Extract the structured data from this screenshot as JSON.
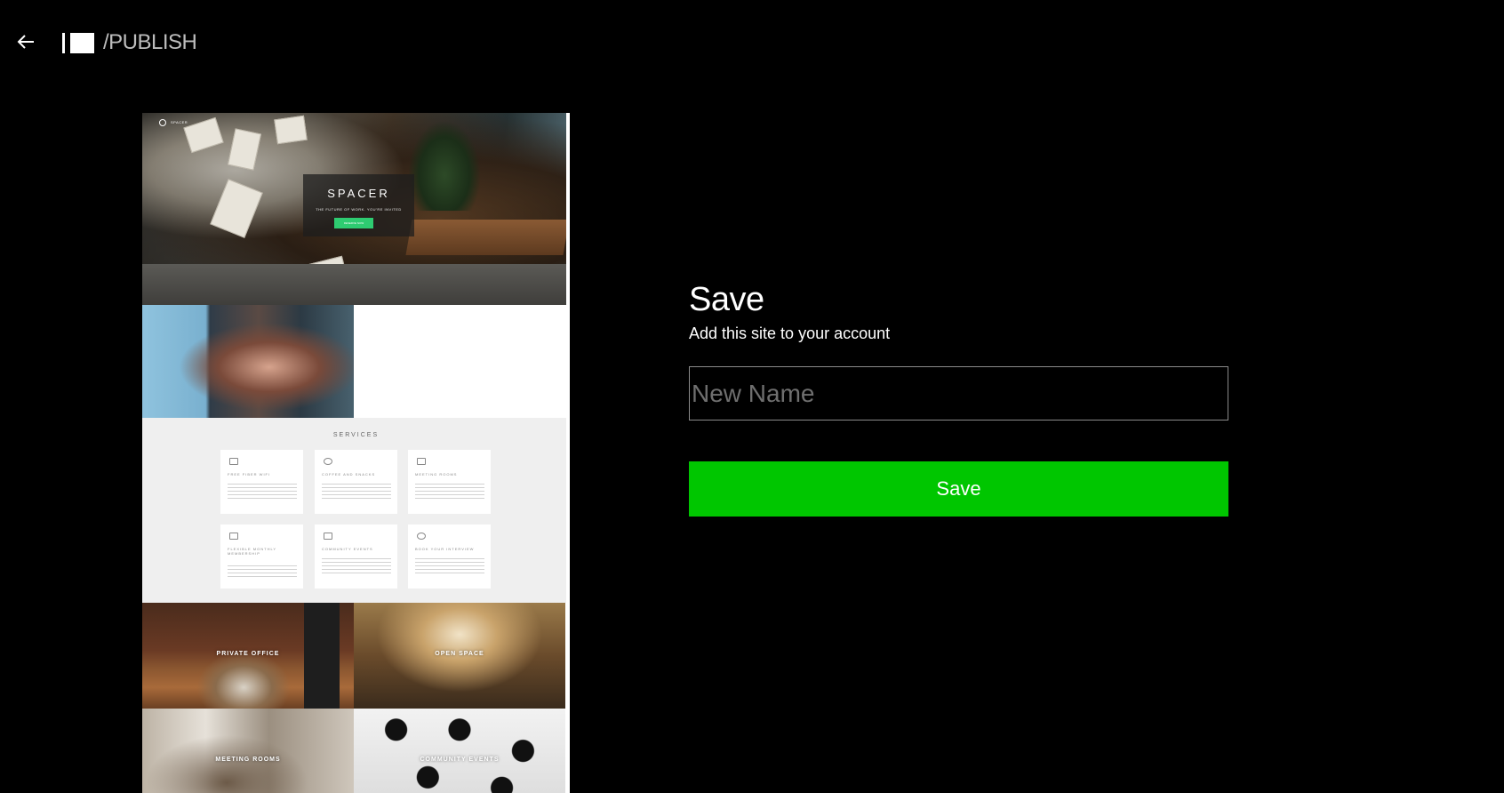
{
  "header": {
    "back_icon": "arrow-left-icon",
    "logo_icon": "publisher-logo-icon",
    "breadcrumb": "/PUBLISH"
  },
  "preview": {
    "hero": {
      "brand": "SPACER",
      "title": "SPACER",
      "subtitle": "THE FUTURE OF WORK. YOU'RE INVITED",
      "cta": "RESERVE NOW"
    },
    "services": {
      "title": "SERVICES",
      "items": [
        {
          "icon": "monitor-icon",
          "name": "FREE FIBER WIFI"
        },
        {
          "icon": "coffee-icon",
          "name": "COFFEE AND SNACKS"
        },
        {
          "icon": "meeting-icon",
          "name": "MEETING ROOMS"
        },
        {
          "icon": "truck-icon",
          "name": "FLEXIBLE MONTHLY MEMBERSHIP"
        },
        {
          "icon": "calendar-icon",
          "name": "COMMUNITY EVENTS"
        },
        {
          "icon": "brain-icon",
          "name": "BOOK YOUR INTERVIEW"
        }
      ]
    },
    "tiles": {
      "private_office": "PRIVATE OFFICE",
      "open_space": "OPEN SPACE",
      "meeting_rooms": "MEETING ROOMS",
      "community_events": "COMMUNITY EVENTS"
    }
  },
  "form": {
    "title": "Save",
    "subtitle": "Add this site to your account",
    "name_placeholder": "New Name",
    "name_value": "",
    "save_label": "Save"
  },
  "colors": {
    "background": "#000000",
    "accent": "#00c600",
    "input_border": "#8a8a8a"
  }
}
